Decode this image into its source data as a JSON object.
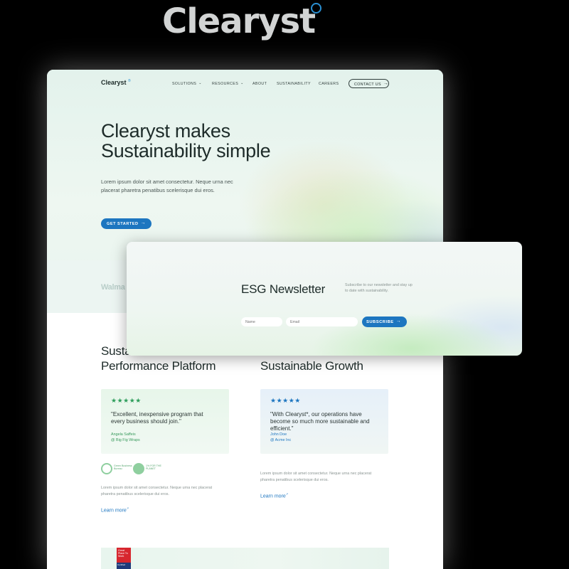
{
  "top_logo": {
    "text": "Clearyst",
    "accent_color": "#2a8fd1"
  },
  "nav": {
    "logo": "Clearyst",
    "logo_mark": "®",
    "items": [
      {
        "label": "SOLUTIONS",
        "has_caret": true
      },
      {
        "label": "RESOURCES",
        "has_caret": true
      },
      {
        "label": "ABOUT",
        "has_caret": false
      },
      {
        "label": "SUSTAINABILITY",
        "has_caret": false
      },
      {
        "label": "CAREERS",
        "has_caret": false
      }
    ],
    "contact_label": "CONTACT US"
  },
  "hero": {
    "title_line1": "Clearyst makes",
    "title_line2": "Sustainability simple",
    "description": "Lorem ipsum dolor sit amet consectetur. Neque urna nec placerat pharetra penatibus scelerisque dui eros.",
    "cta_label": "GET STARTED"
  },
  "logo_strip": {
    "partial_logo": "Walma"
  },
  "columns": [
    {
      "title_line1": "Susta",
      "title_line2": "Performance Platform",
      "review": {
        "stars": "★★★★★",
        "star_color": "#2e9e5b",
        "quote": "\"Excellent, inexpensive program that every business should join.\"",
        "name": "Angela Saffeis",
        "company": "@ Big Fig Wraps",
        "accent": "#3a9a5d"
      },
      "badges": [
        {
          "label": "Green Business Bureau",
          "icon": "leaf-badge-icon"
        },
        {
          "label": "1% FOR THE PLANET",
          "icon": "planet-badge-icon"
        }
      ],
      "description": "Lorem ipsum dolor sit amet consectetur. Neque urna nec placerat pharetra penatibus scelerisque dui eros.",
      "learn_more": "Learn more"
    },
    {
      "title_line1": "",
      "title_line2": "Sustainable Growth",
      "review": {
        "stars": "★★★★★",
        "star_color": "#1d76c0",
        "quote": "\"With Clearyst*, our operations have become so much more sustainable and efficient.\"",
        "name": "John Doe",
        "company": "@ Acme Inc",
        "accent": "#1d76c0"
      },
      "description": "Lorem ipsum dolor sit amet consectetur. Neque urna nec placerat pharetra penatibus scelerisque dui eros.",
      "learn_more": "Learn more"
    }
  ],
  "certification": {
    "badge_text": "Great Place To Work",
    "badge_sub": "Certified"
  },
  "newsletter": {
    "title": "ESG Newsletter",
    "description": "Subscribe to our newsletter and stay up to date with sustainability.",
    "name_placeholder": "Name",
    "email_placeholder": "Email",
    "subscribe_label": "SUBSCRIBE"
  }
}
